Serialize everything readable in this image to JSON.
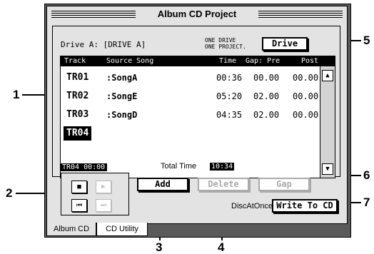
{
  "window": {
    "title": "Album CD Project"
  },
  "drive": {
    "label": "Drive A: [DRIVE A]",
    "info_line1": "ONE DRIVE",
    "info_line2": "ONE PROJECT.",
    "button": "Drive"
  },
  "table": {
    "headers": {
      "track": "Track",
      "source": "Source Song",
      "time": "Time",
      "gap_pre": "Gap: Pre",
      "post": "Post"
    },
    "rows": [
      {
        "track": "TR01",
        "song": ":SongA",
        "time": "00:36",
        "gap": "00.00",
        "post": "00.00"
      },
      {
        "track": "TR02",
        "song": ":SongE",
        "time": "05:20",
        "gap": "02.00",
        "post": "00.00"
      },
      {
        "track": "TR03",
        "song": ":SongD",
        "time": "04:35",
        "gap": "02.00",
        "post": "00.00"
      },
      {
        "track": "TR04",
        "song": "",
        "time": "",
        "gap": "",
        "post": ""
      }
    ]
  },
  "status": {
    "current": "TR04  00:00",
    "total_label": "Total Time",
    "total_value": "10:34"
  },
  "transport": {
    "stop": "■",
    "play": "▶",
    "rewind": "⏮",
    "forward": "⏭"
  },
  "buttons": {
    "add": "Add",
    "delete": "Delete",
    "gap": "Gap",
    "write": "Write To CD"
  },
  "disc_at_once": "DiscAtOnce ▸",
  "tabs": {
    "album_cd": "Album CD",
    "cd_utility": "CD Utility"
  },
  "callouts": {
    "c1": "1",
    "c2": "2",
    "c3": "3",
    "c4": "4",
    "c5": "5",
    "c6": "6",
    "c7": "7"
  }
}
